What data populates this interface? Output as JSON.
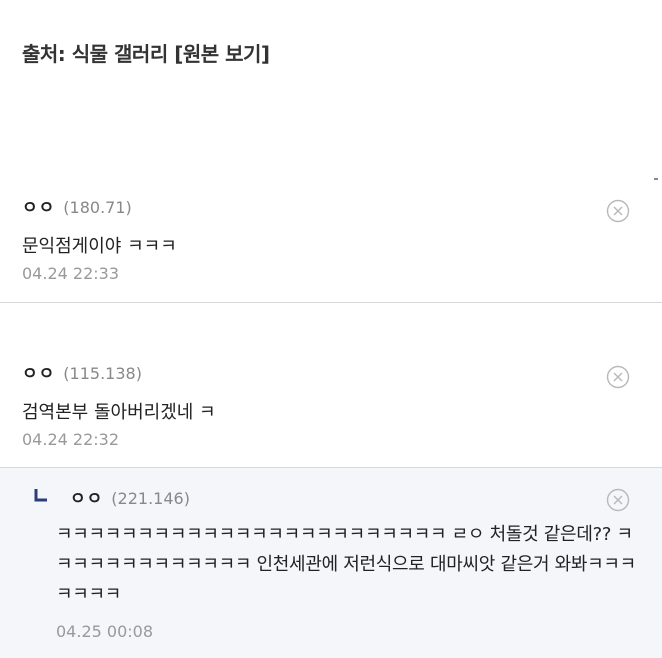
{
  "source": {
    "prefix": "출처: ",
    "gallery_name": "식물 갤러리",
    "view_original": "[원본 보기]"
  },
  "comments": [
    {
      "nickname": "ㅇㅇ",
      "ip": "(180.71)",
      "text": "문익점게이야 ㅋㅋㅋ",
      "date": "04.24 22:33",
      "delete_icon": "circle-x-icon"
    },
    {
      "nickname": "ㅇㅇ",
      "ip": "(115.138)",
      "text": "검역본부 돌아버리겠네 ㅋ",
      "date": "04.24 22:32",
      "delete_icon": "circle-x-icon"
    }
  ],
  "reply": {
    "nickname": "ㅇㅇ",
    "ip": "(221.146)",
    "text": "ㅋㅋㅋㅋㅋㅋㅋㅋㅋㅋㅋㅋㅋㅋㅋㅋㅋㅋㅋㅋㅋㅋㅋㅋ ㄹㅇ 처돌것 같은데?? ㅋㅋㅋㅋㅋㅋㅋㅋㅋㅋㅋㅋㅋ 인천세관에 저런식으로 대마씨앗 같은거 와봐ㅋㅋㅋㅋㅋㅋㅋ",
    "date": "04.25 00:08",
    "reply_icon": "reply-arrow-icon",
    "delete_icon": "circle-x-icon"
  },
  "colors": {
    "text": "#222222",
    "muted": "#888888",
    "date": "#999999",
    "divider": "#d8d8dc",
    "reply_bg": "#f5f6fa",
    "reply_mark": "#2c3e7a"
  }
}
